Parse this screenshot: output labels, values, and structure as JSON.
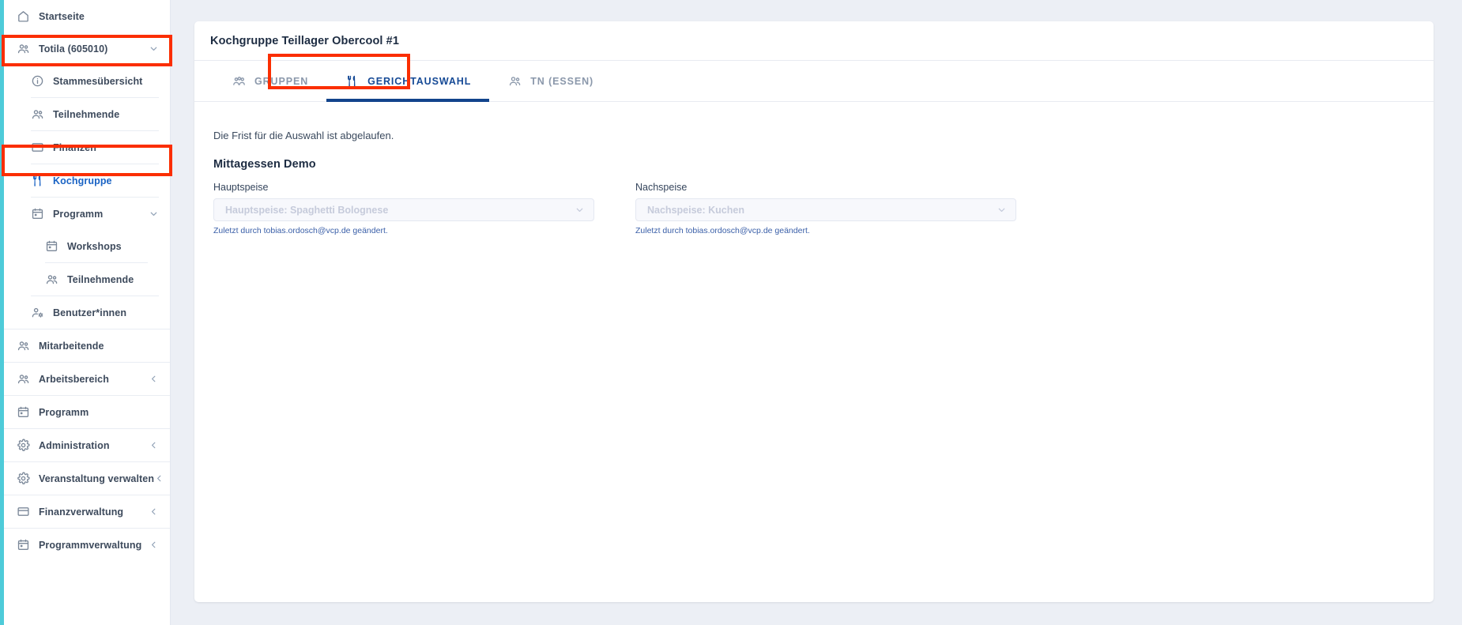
{
  "sidebar": {
    "accent_color": "#4ecbd9",
    "items": [
      {
        "label": "Startseite",
        "icon": "home-icon",
        "level": 1,
        "chevron": "",
        "active": false,
        "name": "startseite"
      },
      {
        "label": "Totila (605010)",
        "icon": "group-icon",
        "level": 1,
        "chevron": "chevron-down-icon",
        "active": false,
        "name": "totila"
      },
      {
        "label": "Stammesübersicht",
        "icon": "info-icon",
        "level": 2,
        "chevron": "",
        "active": false,
        "name": "stammesuebersicht"
      },
      {
        "label": "Teilnehmende",
        "icon": "group-icon",
        "level": 2,
        "chevron": "",
        "active": false,
        "name": "teilnehmende-stamm"
      },
      {
        "label": "Finanzen",
        "icon": "card-icon",
        "level": 2,
        "chevron": "",
        "active": false,
        "name": "finanzen"
      },
      {
        "label": "Kochgruppe",
        "icon": "cutlery-icon",
        "level": 2,
        "chevron": "",
        "active": true,
        "name": "kochgruppe"
      },
      {
        "label": "Programm",
        "icon": "calendar-icon",
        "level": 2,
        "chevron": "chevron-down-icon",
        "active": false,
        "name": "programm-sub"
      },
      {
        "label": "Workshops",
        "icon": "calendar-icon",
        "level": 3,
        "chevron": "",
        "active": false,
        "name": "workshops"
      },
      {
        "label": "Teilnehmende",
        "icon": "group-icon",
        "level": 3,
        "chevron": "",
        "active": false,
        "name": "teilnehmende-programm"
      },
      {
        "label": "Benutzer*innen",
        "icon": "user-gear-icon",
        "level": 2,
        "chevron": "",
        "active": false,
        "name": "benutzerinnen"
      },
      {
        "label": "Mitarbeitende",
        "icon": "group-icon",
        "level": 1,
        "chevron": "",
        "active": false,
        "name": "mitarbeitende"
      },
      {
        "label": "Arbeitsbereich",
        "icon": "group-icon",
        "level": 1,
        "chevron": "chevron-left-icon",
        "active": false,
        "name": "arbeitsbereich"
      },
      {
        "label": "Programm",
        "icon": "calendar-icon",
        "level": 1,
        "chevron": "",
        "active": false,
        "name": "programm"
      },
      {
        "label": "Administration",
        "icon": "gear-icon",
        "level": 1,
        "chevron": "chevron-left-icon",
        "active": false,
        "name": "administration"
      },
      {
        "label": "Veranstaltung verwalten",
        "icon": "gear-icon",
        "level": 1,
        "chevron": "chevron-left-icon",
        "active": false,
        "name": "veranstaltung-verwalten"
      },
      {
        "label": "Finanzverwaltung",
        "icon": "card-icon",
        "level": 1,
        "chevron": "chevron-left-icon",
        "active": false,
        "name": "finanzverwaltung"
      },
      {
        "label": "Programmverwaltung",
        "icon": "calendar-icon",
        "level": 1,
        "chevron": "chevron-left-icon",
        "active": false,
        "name": "programmverwaltung"
      }
    ]
  },
  "card": {
    "title": "Kochgruppe Teillager Obercool #1"
  },
  "tabs": [
    {
      "label": "GRUPPEN",
      "icon": "people-group-icon",
      "selected": false,
      "name": "tab-gruppen"
    },
    {
      "label": "GERICHTAUSWAHL",
      "icon": "cutlery-icon",
      "selected": true,
      "name": "tab-gerichtauswahl"
    },
    {
      "label": "TN (ESSEN)",
      "icon": "group-icon",
      "selected": false,
      "name": "tab-tn-essen"
    }
  ],
  "content": {
    "notice": "Die Frist für die Auswahl ist abgelaufen.",
    "meal_title": "Mittagessen Demo",
    "fields": [
      {
        "label": "Hauptspeise",
        "value": "Hauptspeise: Spaghetti Bolognese",
        "hint": "Zuletzt durch tobias.ordosch@vcp.de geändert.",
        "name": "hauptspeise"
      },
      {
        "label": "Nachspeise",
        "value": "Nachspeise: Kuchen",
        "hint": "Zuletzt durch tobias.ordosch@vcp.de geändert.",
        "name": "nachspeise"
      }
    ]
  },
  "highlights": {
    "color": "#fb2e01"
  }
}
